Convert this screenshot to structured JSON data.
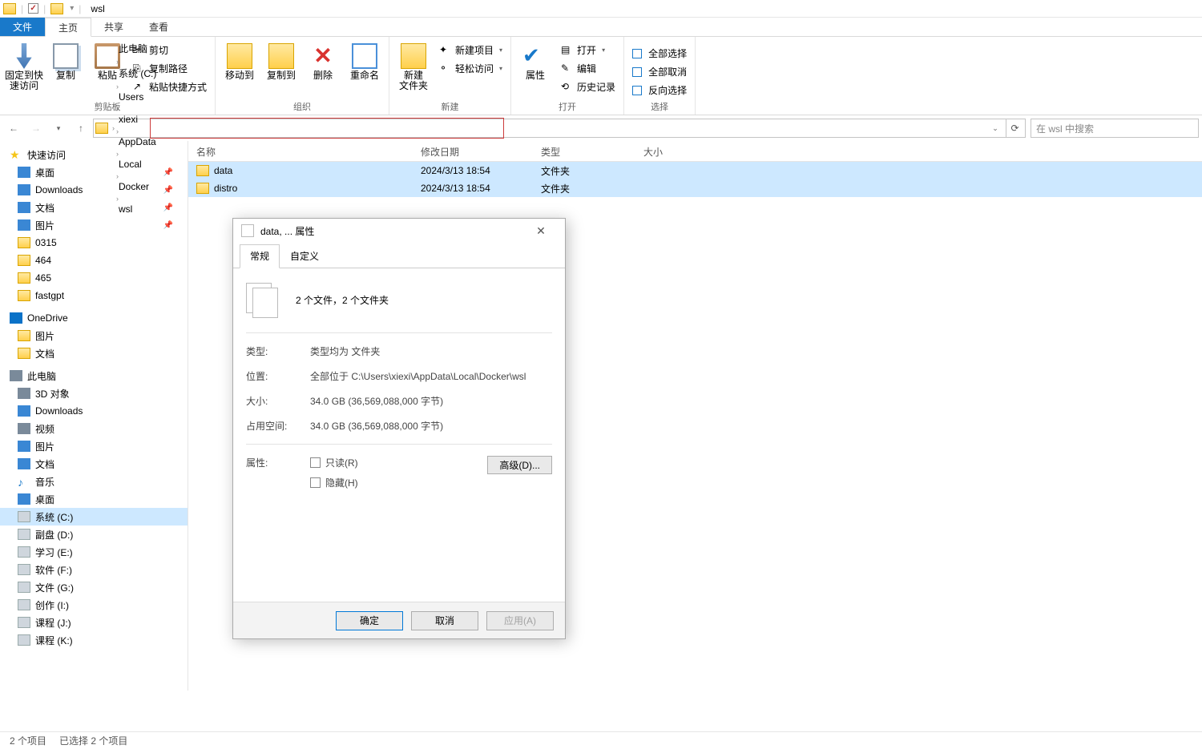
{
  "titlebar": {
    "title": "wsl"
  },
  "tabs": {
    "file": "文件",
    "home": "主页",
    "share": "共享",
    "view": "查看"
  },
  "ribbon": {
    "clipboard": {
      "pin": "固定到快\n速访问",
      "copy": "复制",
      "paste": "粘贴",
      "cut": "剪切",
      "copypath": "复制路径",
      "pasteshortcut": "粘贴快捷方式",
      "label": "剪贴板"
    },
    "organize": {
      "moveto": "移动到",
      "copyto": "复制到",
      "delete": "删除",
      "rename": "重命名",
      "label": "组织"
    },
    "new": {
      "newfolder": "新建\n文件夹",
      "newitem": "新建项目",
      "easyaccess": "轻松访问",
      "label": "新建"
    },
    "open": {
      "properties": "属性",
      "open": "打开",
      "edit": "编辑",
      "history": "历史记录",
      "label": "打开"
    },
    "select": {
      "selectall": "全部选择",
      "selectnone": "全部取消",
      "invert": "反向选择",
      "label": "选择"
    }
  },
  "breadcrumb": [
    "此电脑",
    "系统 (C:)",
    "Users",
    "xiexi",
    "AppData",
    "Local",
    "Docker",
    "wsl"
  ],
  "search": {
    "placeholder": "在 wsl 中搜索"
  },
  "columns": {
    "name": "名称",
    "date": "修改日期",
    "type": "类型",
    "size": "大小"
  },
  "files": [
    {
      "name": "data",
      "date": "2024/3/13 18:54",
      "type": "文件夹"
    },
    {
      "name": "distro",
      "date": "2024/3/13 18:54",
      "type": "文件夹"
    }
  ],
  "nav": {
    "quickaccess": "快速访问",
    "qa_items": [
      {
        "label": "桌面",
        "cls": "ni-desktop",
        "pin": true
      },
      {
        "label": "Downloads",
        "cls": "ni-dl",
        "pin": true
      },
      {
        "label": "文档",
        "cls": "ni-doc",
        "pin": true
      },
      {
        "label": "图片",
        "cls": "ni-pic",
        "pin": true
      },
      {
        "label": "0315",
        "cls": "ni-folder"
      },
      {
        "label": "464",
        "cls": "ni-folder"
      },
      {
        "label": "465",
        "cls": "ni-folder"
      },
      {
        "label": "fastgpt",
        "cls": "ni-folder"
      }
    ],
    "onedrive": "OneDrive",
    "od_items": [
      {
        "label": "图片",
        "cls": "ni-folder"
      },
      {
        "label": "文档",
        "cls": "ni-folder"
      }
    ],
    "thispc": "此电脑",
    "pc_items": [
      {
        "label": "3D 对象",
        "cls": "ni-pc"
      },
      {
        "label": "Downloads",
        "cls": "ni-dl"
      },
      {
        "label": "视频",
        "cls": "ni-pc"
      },
      {
        "label": "图片",
        "cls": "ni-pic"
      },
      {
        "label": "文档",
        "cls": "ni-doc"
      },
      {
        "label": "音乐",
        "cls": "ni-music",
        "glyph": "♪"
      },
      {
        "label": "桌面",
        "cls": "ni-desktop"
      },
      {
        "label": "系统 (C:)",
        "cls": "ni-drive",
        "selected": true
      },
      {
        "label": "副盘 (D:)",
        "cls": "ni-drive"
      },
      {
        "label": "学习 (E:)",
        "cls": "ni-drive"
      },
      {
        "label": "软件 (F:)",
        "cls": "ni-drive"
      },
      {
        "label": "文件 (G:)",
        "cls": "ni-drive"
      },
      {
        "label": "创作 (I:)",
        "cls": "ni-drive"
      },
      {
        "label": "课程 (J:)",
        "cls": "ni-drive"
      },
      {
        "label": "课程 (K:)",
        "cls": "ni-drive"
      }
    ]
  },
  "status": {
    "count": "2 个项目",
    "selected": "已选择 2 个项目"
  },
  "dialog": {
    "title": "data, ... 属性",
    "tab_general": "常规",
    "tab_custom": "自定义",
    "summary": "2 个文件，2 个文件夹",
    "type_k": "类型:",
    "type_v": "类型均为 文件夹",
    "loc_k": "位置:",
    "loc_v": "全部位于 C:\\Users\\xiexi\\AppData\\Local\\Docker\\wsl",
    "size_k": "大小:",
    "size_v": "34.0 GB (36,569,088,000 字节)",
    "disk_k": "占用空间:",
    "disk_v": "34.0 GB (36,569,088,000 字节)",
    "attr_k": "属性:",
    "readonly": "只读(R)",
    "hidden": "隐藏(H)",
    "advanced": "高级(D)...",
    "ok": "确定",
    "cancel": "取消",
    "apply": "应用(A)"
  }
}
